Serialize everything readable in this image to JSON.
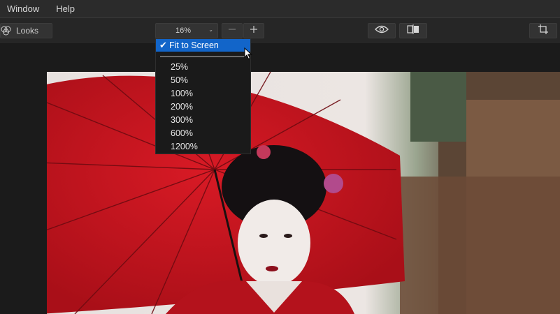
{
  "menubar": {
    "items": [
      "Window",
      "Help"
    ]
  },
  "toolbar": {
    "looks_label": "Looks",
    "zoom_value": "16%",
    "zoom_out_icon": "minus-icon",
    "zoom_in_icon": "plus-icon",
    "preview_icon": "eye-icon",
    "compare_icon": "split-compare-icon",
    "crop_icon": "crop-icon"
  },
  "zoom_menu": {
    "selected": "Fit to Screen",
    "options": [
      "25%",
      "50%",
      "100%",
      "200%",
      "300%",
      "600%",
      "1200%"
    ]
  },
  "colors": {
    "accent": "#1265c9",
    "menubar_bg": "#2b2b2b",
    "toolbar_bg": "#262626",
    "canvas_bg": "#1b1b1b",
    "umbrella_red": "#c5141e"
  }
}
